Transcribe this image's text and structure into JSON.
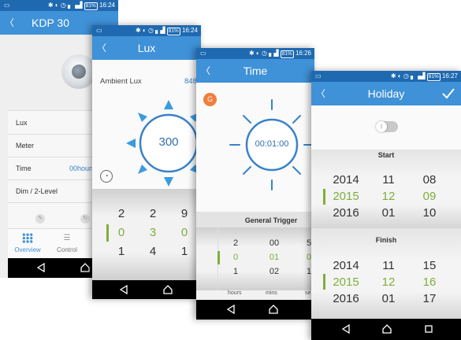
{
  "status": {
    "battery": "81%",
    "times": [
      "16:24",
      "16:24",
      "16:26",
      "16:27"
    ]
  },
  "screen1": {
    "title": "KDP 30",
    "list": [
      {
        "label": "Lux",
        "value": ""
      },
      {
        "label": "Meter",
        "value": ""
      },
      {
        "label": "Time",
        "value": "00hours"
      },
      {
        "label": "Dim / 2-Level",
        "value": ""
      }
    ],
    "tabs": [
      "Overview",
      "Control"
    ]
  },
  "screen2": {
    "title": "Lux",
    "ambient_label": "Ambient Lux",
    "ambient_value": "848",
    "setpoint": "300",
    "picker": [
      [
        "2",
        "0",
        "1"
      ],
      [
        "2",
        "3",
        "4"
      ],
      [
        "9",
        "0",
        "1"
      ]
    ]
  },
  "screen3": {
    "title": "Time",
    "badge": "G",
    "timer": "00:01:00",
    "trigger_label": "General Trigger",
    "picker": [
      [
        "2",
        "0",
        "1"
      ],
      [
        "00",
        "01",
        "02"
      ],
      [
        "5",
        "0",
        "1"
      ]
    ],
    "units": [
      "hours",
      "mins",
      "se"
    ]
  },
  "screen4": {
    "title": "Holiday",
    "start_label": "Start",
    "finish_label": "Finish",
    "start": [
      [
        "2014",
        "2015",
        "2016"
      ],
      [
        "11",
        "12",
        "01"
      ],
      [
        "08",
        "09",
        "10"
      ]
    ],
    "finish": [
      [
        "2014",
        "2015",
        "2016"
      ],
      [
        "11",
        "12",
        "01"
      ],
      [
        "15",
        "16",
        "17"
      ]
    ]
  },
  "colors": {
    "statusbar": "#1f69b1",
    "appbar": "#3f91d8",
    "accent": "#7fae3c",
    "dial": "#3a82c8",
    "badge": "#f07f3c"
  }
}
